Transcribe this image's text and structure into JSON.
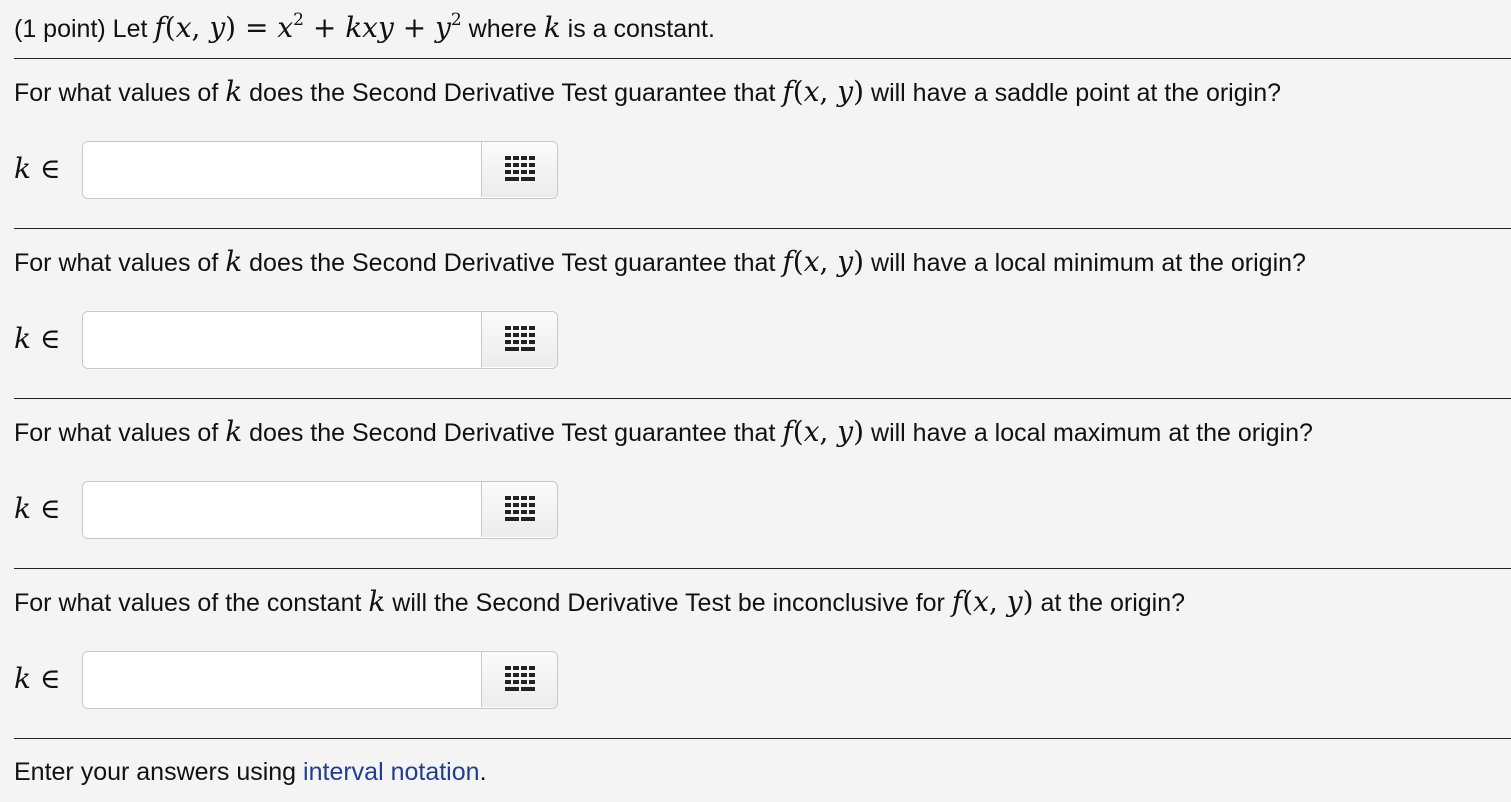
{
  "header": {
    "points": "(1 point)",
    "let_word": "Let",
    "where_text": "where",
    "constant_text": "is a constant."
  },
  "questions": [
    {
      "prefix": "For what values of",
      "middle": "does the Second Derivative Test guarantee that",
      "suffix": "will have a saddle point at the origin?",
      "answer_label": "k ∈",
      "answer_value": ""
    },
    {
      "prefix": "For what values of",
      "middle": "does the Second Derivative Test guarantee that",
      "suffix": "will have a local minimum at the origin?",
      "answer_label": "k ∈",
      "answer_value": ""
    },
    {
      "prefix": "For what values of",
      "middle": "does the Second Derivative Test guarantee that",
      "suffix": "will have a local maximum at the origin?",
      "answer_label": "k ∈",
      "answer_value": ""
    },
    {
      "prefix": "For what values of the constant",
      "middle": "will the Second Derivative Test be inconclusive for",
      "suffix": "at the origin?",
      "answer_label": "k ∈",
      "answer_value": ""
    }
  ],
  "footer": {
    "prefix": "Enter your answers using",
    "link_text": "interval notation",
    "suffix": "."
  },
  "icons": {
    "keypad": "grid-keypad-icon"
  },
  "colors": {
    "background": "#f4f4f4",
    "link": "#1f3e8f",
    "rule": "#222222"
  }
}
